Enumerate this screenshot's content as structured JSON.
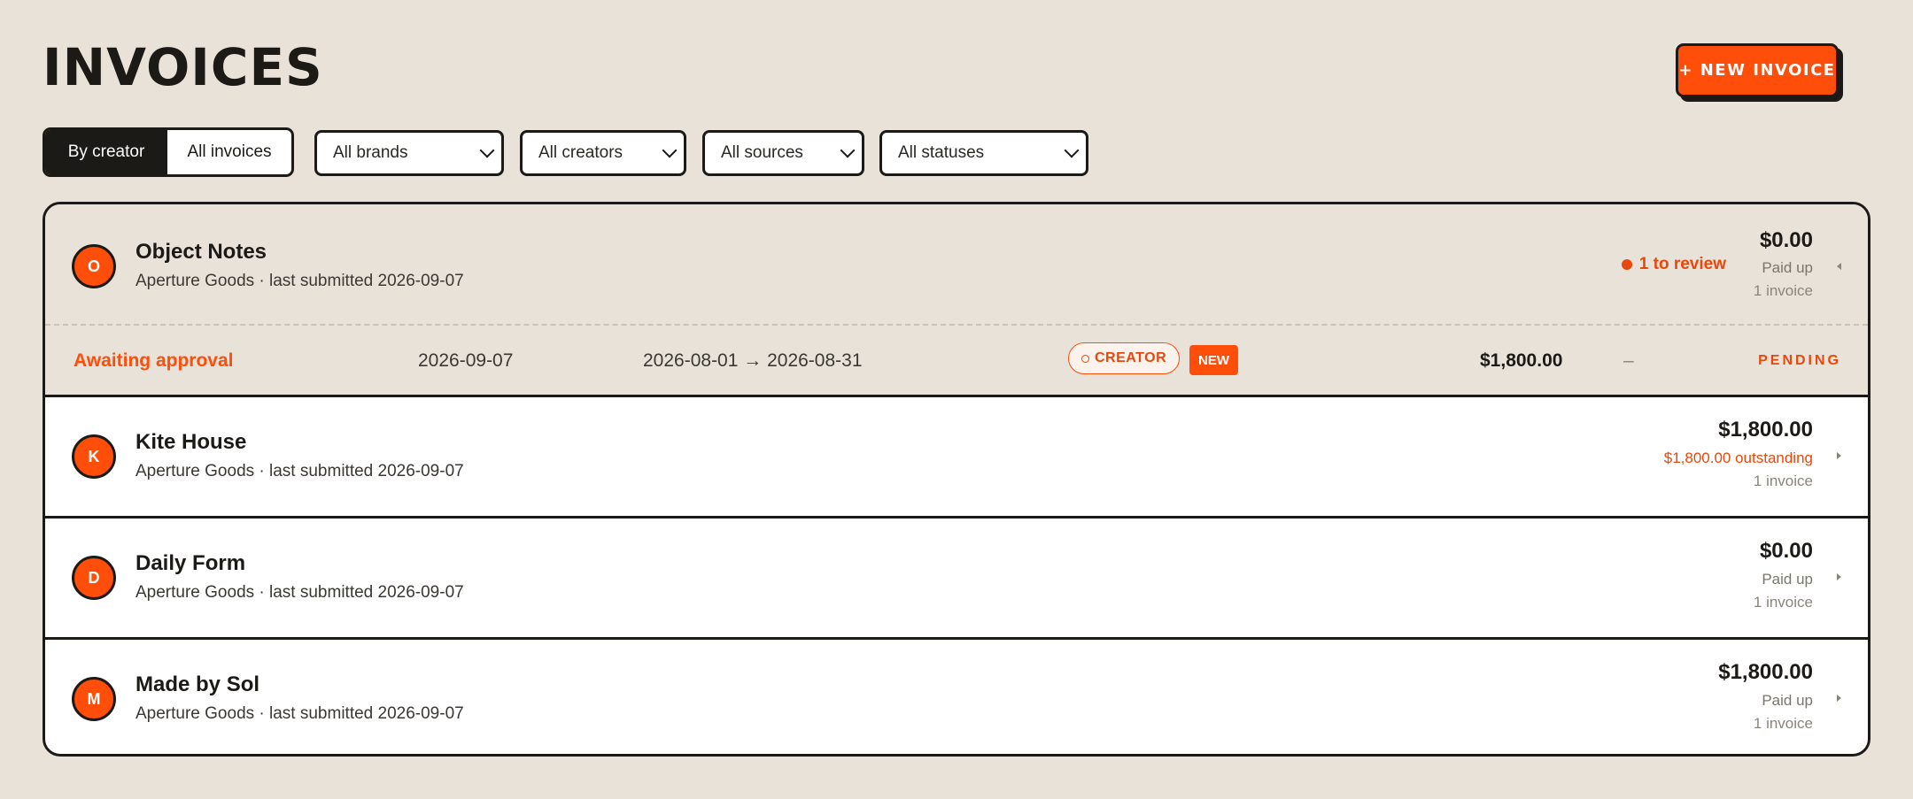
{
  "page": {
    "title": "INVOICES"
  },
  "actions": {
    "new_invoice": "+ NEW INVOICE"
  },
  "filters": {
    "view_toggle": {
      "active": "By creator",
      "inactive": "All invoices"
    },
    "brands": "All brands",
    "creators": "All creators",
    "sources": "All sources",
    "statuses": "All statuses"
  },
  "creators": [
    {
      "initial": "O",
      "name": "Object Notes",
      "meta": "Aperture Goods · last submitted 2026-09-07",
      "amount": "$0.00",
      "status": "Paid up",
      "count": "1 invoice",
      "review": "1 to review"
    },
    {
      "initial": "K",
      "name": "Kite House",
      "meta": "Aperture Goods · last submitted 2026-09-07",
      "amount": "$1,800.00",
      "status": "$1,800.00 outstanding",
      "count": "1 invoice"
    },
    {
      "initial": "D",
      "name": "Daily Form",
      "meta": "Aperture Goods · last submitted 2026-09-07",
      "amount": "$0.00",
      "status": "Paid up",
      "count": "1 invoice"
    },
    {
      "initial": "M",
      "name": "Made by Sol",
      "meta": "Aperture Goods · last submitted 2026-09-07",
      "amount": "$1,800.00",
      "status": "Paid up",
      "count": "1 invoice"
    }
  ],
  "expanded_invoice": {
    "state": "Awaiting approval",
    "submitted": "2026-09-07",
    "period": "2026-08-01 → 2026-08-31",
    "source_tag": "CREATOR",
    "new_tag": "NEW",
    "amount": "$1,800.00",
    "paid": "–",
    "status": "PENDING"
  },
  "colors": {
    "accent": "#ff4e0a",
    "ink": "#1c1a17",
    "background": "#e9e2d8"
  }
}
